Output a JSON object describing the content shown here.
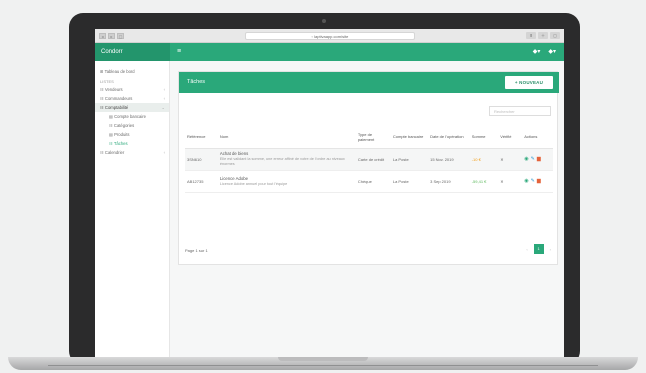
{
  "browser": {
    "url": "▫ laptivaapp.com/site",
    "left_buttons": [
      "◂",
      "▸",
      "▢"
    ],
    "right_buttons": [
      "⬆",
      "＋",
      "▢"
    ]
  },
  "app": {
    "brand": "Condorr",
    "menu_toggle": "≡",
    "nav_right_1": "◆▾",
    "nav_right_2": "◆▾"
  },
  "sidebar": {
    "dashboard": "⊞  Tableau de bord",
    "section": "LISTES",
    "items": [
      {
        "label": "☷  Vendeurs",
        "chev": "‹"
      },
      {
        "label": "☷  Commandeurs",
        "chev": "‹"
      },
      {
        "label": "☷  Comptabilité",
        "chev": "⌄"
      }
    ],
    "subitems": [
      "▤  Compte bancaire",
      "☷  Catégories",
      "▤  Produits",
      "☷  Tâches"
    ],
    "last": {
      "label": "☷  Calendrier",
      "chev": "‹"
    }
  },
  "panel": {
    "title": "Tâches",
    "new_button": "+ NOUVEAU",
    "search_placeholder": "Rechercher"
  },
  "table": {
    "headers": [
      "Référence",
      "Nom",
      "",
      "Type de paiement",
      "Compte bancaire",
      "Date de l'opération",
      "Somme",
      "Vérifié",
      "Actions"
    ],
    "rows": [
      {
        "ref": "3SN610",
        "name": "Achat de biens",
        "desc": "Elle est validant la somme, une erreur affiné de votre de l'ordre au niveaux énormes",
        "type": "Carte de crédit",
        "account": "La Poste",
        "date": "15 Nov. 2019",
        "amount": "-10 €",
        "verified": "✕"
      },
      {
        "ref": "AB12735",
        "name": "Licence Adobe",
        "desc": "Licence Adobe annuel pour tout l'équipe",
        "type": "Chèque",
        "account": "La Poste",
        "date": "3 Sep 2019",
        "amount": "-59,41 €",
        "verified": "✕"
      }
    ]
  },
  "icons": {
    "view": "◉",
    "edit": "✎",
    "delete": "▆"
  },
  "footer": {
    "page_info": "Page 1 sur 1",
    "prev": "‹",
    "current": "1",
    "next": "›"
  },
  "colors": {
    "primary": "#2aa87a",
    "primary_dark": "#23956c",
    "orange": "#f39c12",
    "green": "#5cb85c"
  }
}
